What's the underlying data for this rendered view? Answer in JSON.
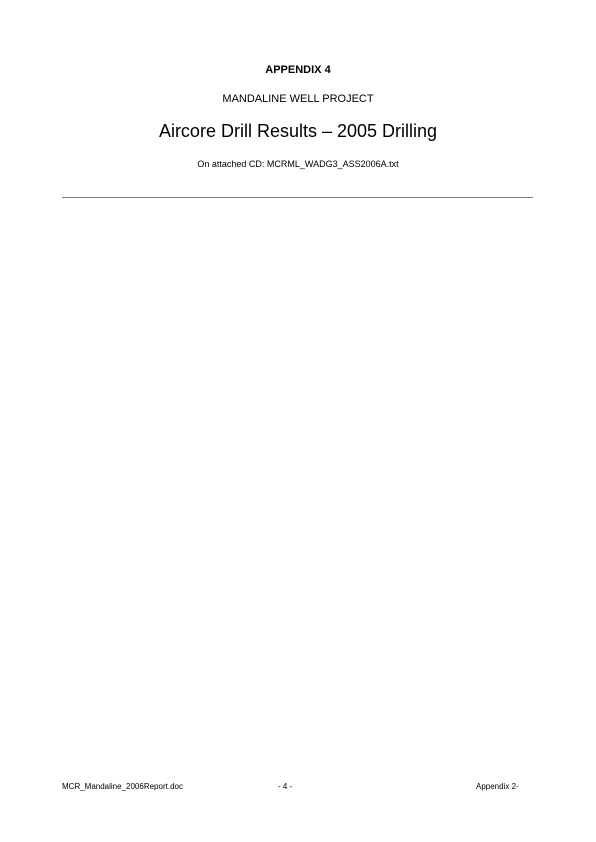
{
  "header": {
    "appendix_label": "APPENDIX 4",
    "project_name": "MANDALINE WELL PROJECT",
    "title": "Aircore Drill Results – 2005 Drilling",
    "cd_note": "On attached CD: MCRML_WADG3_ASS2006A.txt"
  },
  "footer": {
    "filename": "MCR_Mandaline_2006Report.doc",
    "page_number": "- 4 -",
    "appendix_ref": "Appendix 2-"
  }
}
